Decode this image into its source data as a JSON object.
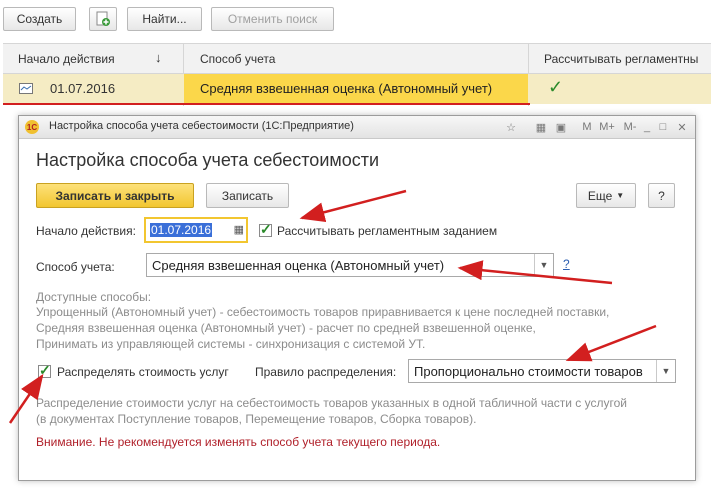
{
  "toolbar": {
    "create_label": "Создать",
    "find_label": "Найти...",
    "cancel_search_label": "Отменить поиск"
  },
  "grid": {
    "headers": [
      "Начало действия",
      "Способ учета",
      "Рассчитывать регламентны"
    ],
    "sort_arrow": "↓",
    "row": {
      "date": "01.07.2016",
      "method": "Средняя взвешенная оценка (Автономный учет)",
      "check": "✓"
    }
  },
  "dialog": {
    "window_title": "Настройка способа учета себестоимости  (1С:Предприятие)",
    "heading": "Настройка способа учета себестоимости",
    "save_close_label": "Записать и закрыть",
    "save_label": "Записать",
    "more_label": "Еще",
    "help_label": "?",
    "start_label": "Начало действия:",
    "start_value": "01.07.2016",
    "calc_label": "Рассчитывать регламентным заданием",
    "method_label": "Способ учета:",
    "method_value": "Средняя взвешенная оценка (Автономный учет)",
    "method_help": "?",
    "available_title": "Доступные способы:",
    "available_lines": [
      "Упрощенный (Автономный учет) - себестоимость товаров приравнивается к цене последней поставки,",
      "Средняя взвешенная оценка (Автономный учет) - расчет по средней взвешенной оценке,",
      "Принимать из управляющей системы - синхронизация с системой УТ."
    ],
    "distribute_label": "Распределять стоимость услуг",
    "rule_label": "Правило распределения:",
    "rule_value": "Пропорционально стоимости товаров",
    "distribute_desc": [
      "Распределение стоимости услуг на себестоимость товаров указанных в одной табличной части с услугой",
      "(в документах Поступление товаров, Перемещение товаров, Сборка товаров)."
    ],
    "warning": "Внимание. Не рекомендуется изменять способ учета текущего периода."
  },
  "colors": {
    "accent_yellow": "#fbd74a",
    "arrow_red": "#d21f1f",
    "warning_red": "#b0202a",
    "check_green": "#2a8a2a"
  }
}
